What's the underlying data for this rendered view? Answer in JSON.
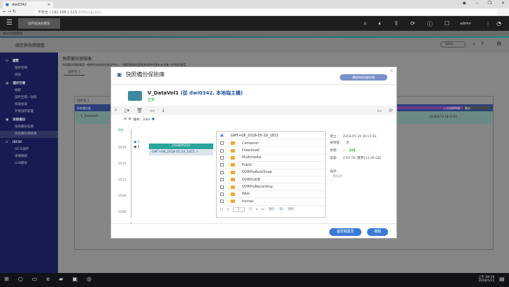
{
  "browser": {
    "tab_title": "dwi0342",
    "url_host": "192.168.1.115",
    "url_rest": ":8080/cgi-bin/",
    "security": "不安全"
  },
  "apphead": {
    "app_tab": "儲存與快照總管",
    "user": "admin"
  },
  "app": {
    "strip_title": "儲存與快照總管",
    "title": "儲存與快照總管",
    "qtier": "Qtier"
  },
  "sidebar": {
    "groups": [
      {
        "label": "總覽",
        "items": [
          "儲存空間",
          "快照"
        ]
      },
      {
        "label": "儲存空間",
        "items": [
          "磁碟",
          "儲存空間／快照",
          "快取加速",
          "外接儲存裝置"
        ]
      },
      {
        "label": "快照備份",
        "items": [
          "快照備份任務",
          "快照備份保險庫"
        ]
      },
      {
        "label": "iSCSI",
        "items": [
          "iSCSI儲存",
          "遠端磁碟",
          "LUN備份"
        ]
      }
    ]
  },
  "content": {
    "heading": "快照備份保險庫：",
    "desc": "快照備份保險庫是一個供所有接收的儲存中心，可讓您輕鬆的管理其他NAS儲存在本機上的快照檔案。",
    "tab": "儲存池 1",
    "pool_label": "儲存池 1",
    "col_action": "動作",
    "col_last": "上次快照時間",
    "row_name": "V_DataVol1",
    "row_time": "2018/5/19 18:15:03",
    "header_name": "所有儲存區"
  },
  "modal": {
    "title": "快照備份保險庫",
    "free_btn": "釋放快照保險空間",
    "volume": "V_DataVol1",
    "source": "(從 dwi0342, 本地端主機)",
    "status": "正常",
    "snap_label": "總共：3/64",
    "timeline": {
      "top": "現在",
      "dates": [
        "05/18",
        "05/15",
        "05/12",
        "05/09",
        "05/06"
      ],
      "marks": [
        "1",
        "2"
      ],
      "group_date": "2018/05/19",
      "item": "GMT+08_2018-05-19_1815"
    },
    "files": {
      "header": "GMT+08_2018-05-19_1815",
      "items": [
        "Container",
        "Download",
        "Multimedia",
        "Public",
        "QVRProAutoSnap",
        "QVRProDB",
        "QVRProRecording",
        "Web",
        "homes"
      ],
      "page": "1",
      "of": "/1",
      "show": "顯示",
      "per": "50",
      "unit": "項目"
    },
    "details": {
      "time_k": "建立：",
      "time_v": "2018-05-19 18:15:03",
      "lock_k": "被保留：",
      "lock_v": "否",
      "state_k": "狀態：",
      "state_v": "就緒",
      "cap_k": "容量：",
      "cap_v": "2.93 TB (實用112.99 GB)",
      "desc_k": "描述：",
      "desc_v": "無描述"
    },
    "restore_btn": "還原檔案至",
    "clone_btn": "複製"
  },
  "taskbar": {
    "time": "上午 09:16",
    "date": "2018/5/21"
  }
}
